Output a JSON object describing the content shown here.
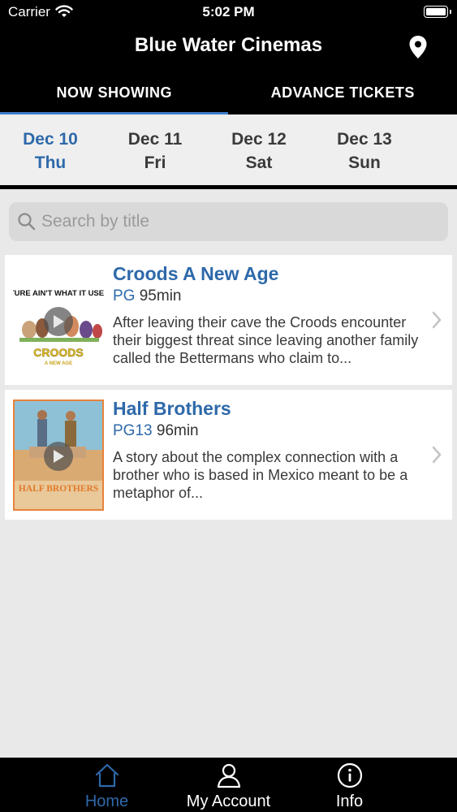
{
  "status_bar": {
    "carrier": "Carrier",
    "time": "5:02 PM"
  },
  "header": {
    "title": "Blue Water Cinemas"
  },
  "tabs": [
    {
      "label": "NOW SHOWING",
      "active": true
    },
    {
      "label": "ADVANCE TICKETS",
      "active": false
    }
  ],
  "dates": [
    {
      "date": "Dec 10",
      "day": "Thu",
      "active": true
    },
    {
      "date": "Dec 11",
      "day": "Fri",
      "active": false
    },
    {
      "date": "Dec 12",
      "day": "Sat",
      "active": false
    },
    {
      "date": "Dec 13",
      "day": "Sun",
      "active": false
    }
  ],
  "search": {
    "placeholder": "Search by title",
    "value": ""
  },
  "movies": [
    {
      "title": "Croods A New Age",
      "rating": "PG",
      "runtime": "95min",
      "description": "After leaving their cave the Croods encounter their biggest threat since leaving another family called the Bettermans who claim to...",
      "poster_tagline": "THE FUTURE AIN'T WHAT IT USED TO BE",
      "poster_logo": "CROODS",
      "poster_sub": "A NEW AGE"
    },
    {
      "title": "Half Brothers",
      "rating": "PG13",
      "runtime": "96min",
      "description": "A story about the complex connection with a brother who is based in Mexico meant to be a metaphor of...",
      "poster_logo": "HALF BROTHERS"
    }
  ],
  "bottom_tabs": [
    {
      "label": "Home",
      "icon": "home-icon",
      "active": true
    },
    {
      "label": "My Account",
      "icon": "person-icon",
      "active": false
    },
    {
      "label": "Info",
      "icon": "info-icon",
      "active": false
    }
  ],
  "colors": {
    "accent": "#2e69aa",
    "indicator": "#3d7ccc",
    "bar_bg": "#000000",
    "page_bg": "#e9e9e9"
  }
}
